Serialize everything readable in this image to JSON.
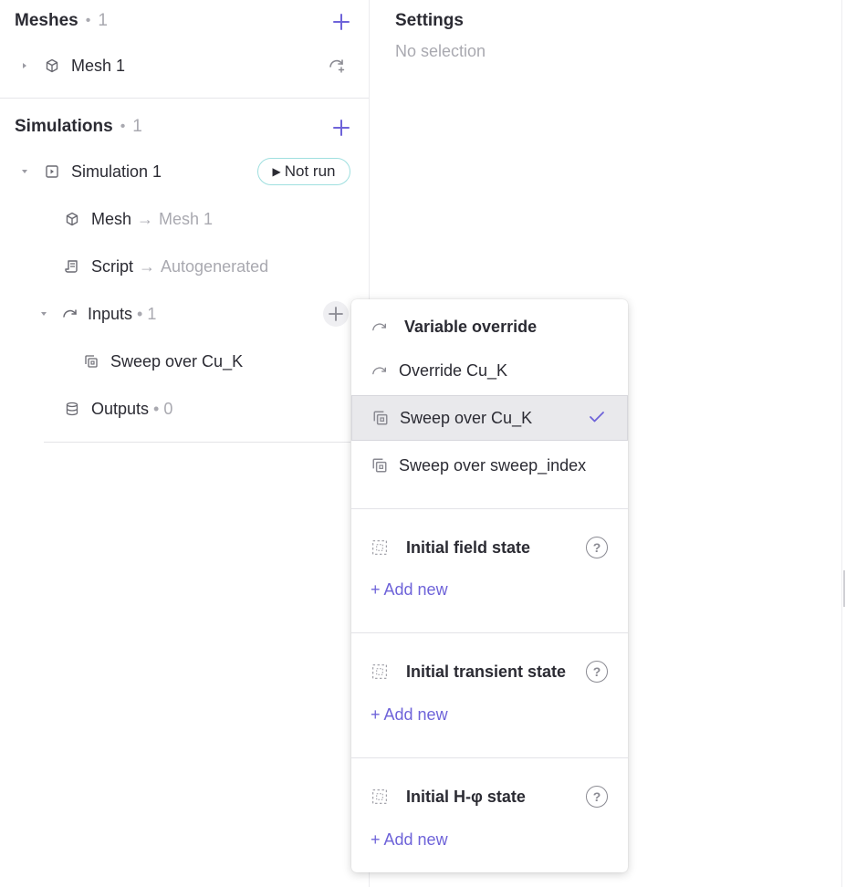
{
  "left": {
    "meshes": {
      "title": "Meshes",
      "count": "1",
      "items": [
        {
          "label": "Mesh 1"
        }
      ]
    },
    "simulations": {
      "title": "Simulations",
      "count": "1",
      "simulation": {
        "label": "Simulation 1",
        "status": "Not run"
      },
      "mesh": {
        "label": "Mesh",
        "target": "Mesh 1"
      },
      "script": {
        "label": "Script",
        "target": "Autogenerated"
      },
      "inputs": {
        "label": "Inputs",
        "count": "1",
        "items": [
          {
            "label": "Sweep over Cu_K"
          }
        ]
      },
      "outputs": {
        "label": "Outputs",
        "count": "0"
      }
    }
  },
  "settings": {
    "title": "Settings",
    "subtitle": "No selection"
  },
  "menu": {
    "variable_override": {
      "header": "Variable override",
      "items": [
        {
          "label": "Override Cu_K",
          "selected": false
        },
        {
          "label": "Sweep over Cu_K",
          "selected": true
        },
        {
          "label": "Sweep over sweep_index",
          "selected": false
        }
      ]
    },
    "sections": [
      {
        "header": "Initial field state",
        "help": "?",
        "add_label": "+ Add new"
      },
      {
        "header": "Initial transient state",
        "help": "?",
        "add_label": "+ Add new"
      },
      {
        "header": "Initial H-φ state",
        "help": "?",
        "add_label": "+ Add new"
      }
    ]
  },
  "colors": {
    "accent": "#6e63d9",
    "badge_border": "#9fdfdf",
    "muted": "#a9a9b0"
  },
  "icons": {
    "mesh": "cube-icon",
    "simulation": "play-square-icon",
    "script": "scroll-icon",
    "inputs": "gauge-icon",
    "sweep": "copy-stack-icon",
    "outputs": "database-icon",
    "state": "dashed-grid-icon"
  }
}
